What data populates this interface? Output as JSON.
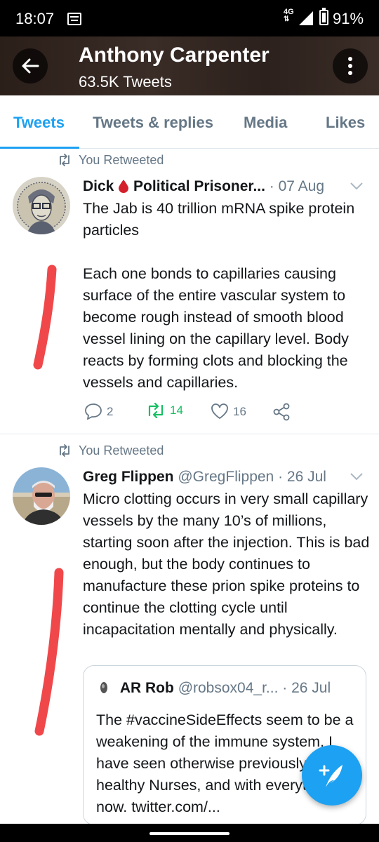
{
  "status_bar": {
    "time": "18:07",
    "network": "4G",
    "battery": "91%"
  },
  "header": {
    "title": "Anthony Carpenter",
    "tweet_count": "63.5K Tweets"
  },
  "tabs": [
    {
      "label": "Tweets",
      "active": true
    },
    {
      "label": "Tweets & replies",
      "active": false
    },
    {
      "label": "Media",
      "active": false
    },
    {
      "label": "Likes",
      "active": false
    }
  ],
  "tweets": [
    {
      "retweet_label": "You Retweeted",
      "name_before_icon": "Dick",
      "name_after_icon": "Political Prisoner...",
      "date": "· 07 Aug",
      "body": "The Jab is 40 trillion mRNA spike protein particles\n\nEach one bonds to capillaries causing surface of the entire vascular system to become rough instead of smooth blood vessel lining on the capillary level. Body reacts by forming clots and blocking the  vessels and capillaries.",
      "replies": "2",
      "retweets": "14",
      "likes": "16",
      "retweeted": true
    },
    {
      "retweet_label": "You Retweeted",
      "name": "Greg Flippen",
      "handle": "@GregFlippen",
      "date": "· 26 Jul",
      "body": "Micro clotting occurs in very small capillary vessels by the many 10’s of millions, starting soon after the injection. This is bad enough, but the body continues to manufacture these prion spike proteins to continue the clotting cycle until incapacitation mentally and physically.",
      "quote": {
        "name": "AR Rob",
        "handle": "@robsox04_r...",
        "date": "· 26 Jul",
        "body": "The #vaccineSideEffects seem to be a weakening of the immune system. I have seen otherwise previously healthy Nurses, and with everything now. twitter.com/..."
      }
    }
  ],
  "colors": {
    "accent": "#1da1f2",
    "retweet_green": "#17bf63",
    "annotation_red": "#f0484a"
  },
  "icons": [
    "back-arrow-icon",
    "more-vertical-icon",
    "retweet-icon",
    "reply-icon",
    "heart-icon",
    "share-icon",
    "chevron-down-icon",
    "compose-tweet-icon"
  ]
}
